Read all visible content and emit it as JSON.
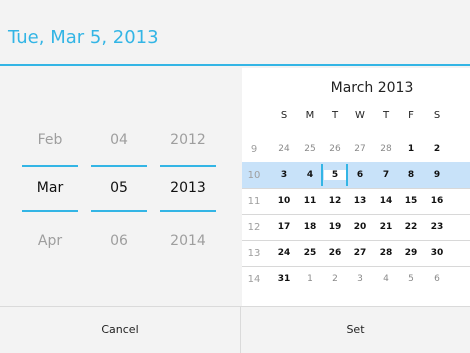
{
  "header": {
    "title": "Tue, Mar 5, 2013"
  },
  "spinners": {
    "month": {
      "prev": "Feb",
      "current": "Mar",
      "next": "Apr"
    },
    "day": {
      "prev": "04",
      "current": "05",
      "next": "06"
    },
    "year": {
      "prev": "2012",
      "current": "2013",
      "next": "2014"
    }
  },
  "calendar": {
    "title": "March 2013",
    "weekdays": [
      "S",
      "M",
      "T",
      "W",
      "T",
      "F",
      "S"
    ],
    "weeks": [
      {
        "num": "9",
        "days": [
          "24",
          "25",
          "26",
          "27",
          "28",
          "1",
          "2"
        ]
      },
      {
        "num": "10",
        "days": [
          "3",
          "4",
          "5",
          "6",
          "7",
          "8",
          "9"
        ]
      },
      {
        "num": "11",
        "days": [
          "10",
          "11",
          "12",
          "13",
          "14",
          "15",
          "16"
        ]
      },
      {
        "num": "12",
        "days": [
          "17",
          "18",
          "19",
          "20",
          "21",
          "22",
          "23"
        ]
      },
      {
        "num": "13",
        "days": [
          "24",
          "25",
          "26",
          "27",
          "28",
          "29",
          "30"
        ]
      },
      {
        "num": "14",
        "days": [
          "31",
          "1",
          "2",
          "3",
          "4",
          "5",
          "6"
        ]
      }
    ]
  },
  "buttons": {
    "cancel": "Cancel",
    "set": "Set"
  },
  "colors": {
    "accent": "#33b5e5",
    "selected_week": "#c8e2f9"
  }
}
